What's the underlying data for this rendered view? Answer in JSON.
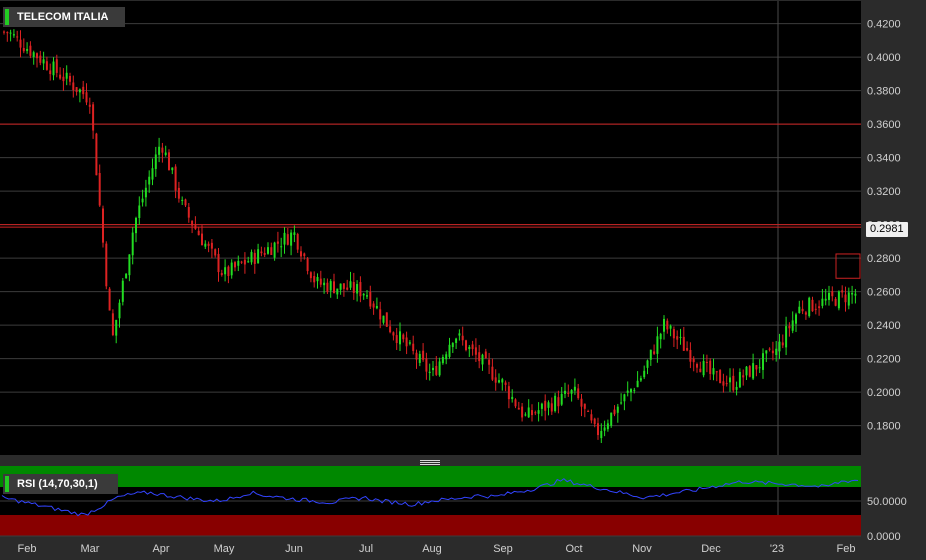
{
  "chart_data": [
    {
      "type": "candlestick",
      "title": "TELECOM ITALIA",
      "last_price_label": "0.2981",
      "y_ticks": [
        "0.1800",
        "0.2000",
        "0.2200",
        "0.2400",
        "0.2600",
        "0.2800",
        "0.3000",
        "0.3200",
        "0.3400",
        "0.3600",
        "0.3800",
        "0.4000",
        "0.4200"
      ],
      "ylim": [
        0.1625,
        0.4335
      ],
      "x_ticks": [
        "Feb",
        "Mar",
        "Apr",
        "May",
        "Jun",
        "Jul",
        "Aug",
        "Sep",
        "Oct",
        "Nov",
        "Dec",
        "'23",
        "Feb"
      ],
      "horizontal_lines": [
        0.36,
        0.3,
        0.2985
      ],
      "approx_path": [
        [
          "Feb",
          0.415
        ],
        [
          "Mar",
          0.375
        ],
        [
          "Mar",
          0.23
        ],
        [
          "Mar",
          0.3
        ],
        [
          "Apr",
          0.35
        ],
        [
          "Apr",
          0.31
        ],
        [
          "May",
          0.27
        ],
        [
          "Jun",
          0.295
        ],
        [
          "Jun",
          0.265
        ],
        [
          "Jul",
          0.26
        ],
        [
          "Jul",
          0.24
        ],
        [
          "Aug",
          0.21
        ],
        [
          "Aug",
          0.235
        ],
        [
          "Sep",
          0.205
        ],
        [
          "Sep",
          0.185
        ],
        [
          "Oct",
          0.2
        ],
        [
          "Oct",
          0.175
        ],
        [
          "Nov",
          0.21
        ],
        [
          "Nov",
          0.24
        ],
        [
          "Dec",
          0.21
        ],
        [
          "Dec",
          0.205
        ],
        [
          "'23",
          0.225
        ],
        [
          "'23",
          0.25
        ],
        [
          "Feb",
          0.26
        ],
        [
          "Feb",
          0.295
        ]
      ],
      "up_color": "#22dd22",
      "down_color": "#dd2222"
    },
    {
      "type": "line",
      "title": "RSI (14,70,30,1)",
      "y_ticks": [
        "0.0000",
        "50.0000"
      ],
      "ylim": [
        0,
        100
      ],
      "overbought": 70,
      "oversold": 30,
      "approx_values": [
        55,
        50,
        45,
        40,
        35,
        30,
        42,
        55,
        60,
        62,
        58,
        55,
        52,
        50,
        54,
        62,
        58,
        55,
        52,
        50,
        48,
        52,
        55,
        50,
        48,
        45,
        50,
        52,
        55,
        58,
        56,
        62,
        66,
        72,
        80,
        75,
        70,
        65,
        60,
        55,
        58,
        62,
        65,
        70,
        74,
        78,
        76,
        75,
        74,
        72,
        70,
        78,
        80
      ],
      "line_color": "#3344ff",
      "overbought_color": "#008800",
      "oversold_color": "#880000"
    }
  ]
}
